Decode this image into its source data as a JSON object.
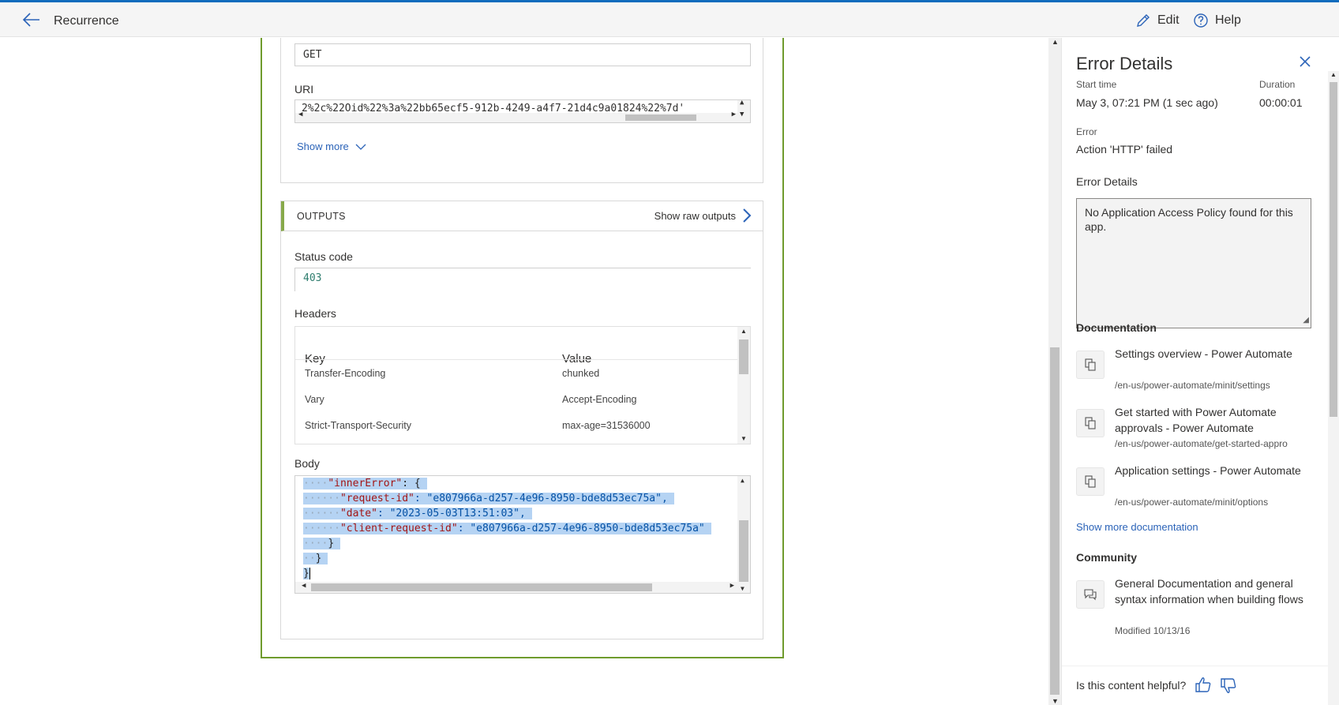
{
  "header": {
    "title": "Recurrence",
    "edit_label": "Edit",
    "help_label": "Help"
  },
  "inputs": {
    "method_value": "GET",
    "uri_label": "URI",
    "uri_value": "2%2c%22Oid%22%3a%22bb65ecf5-912b-4249-a4f7-21d4c9a01824%22%7d'",
    "show_more": "Show more"
  },
  "outputs": {
    "section_title": "OUTPUTS",
    "show_raw": "Show raw outputs",
    "status_label": "Status code",
    "status_value": "403",
    "headers_label": "Headers",
    "headers_columns": [
      "Key",
      "Value"
    ],
    "headers_rows": [
      {
        "key": "Transfer-Encoding",
        "value": "chunked"
      },
      {
        "key": "Vary",
        "value": "Accept-Encoding"
      },
      {
        "key": "Strict-Transport-Security",
        "value": "max-age=31536000"
      }
    ],
    "body_label": "Body",
    "body_lines": [
      {
        "indent": "····",
        "key": "\"innerError\"",
        "rest": ": {"
      },
      {
        "indent": "······",
        "key": "\"request-id\"",
        "rest": ": \"e807966a-d257-4e96-8950-bde8d53ec75a\","
      },
      {
        "indent": "······",
        "key": "\"date\"",
        "rest": ": \"2023-05-03T13:51:03\","
      },
      {
        "indent": "······",
        "key": "\"client-request-id\"",
        "rest": ": \"e807966a-d257-4e96-8950-bde8d53ec75a\""
      },
      {
        "indent": "····",
        "key": "",
        "rest": "}"
      },
      {
        "indent": "··",
        "key": "",
        "rest": "}"
      },
      {
        "indent": "",
        "key": "",
        "rest": "}"
      }
    ]
  },
  "panel": {
    "title": "Error Details",
    "start_time_label": "Start time",
    "start_time_value": "May 3, 07:21 PM (1 sec ago)",
    "duration_label": "Duration",
    "duration_value": "00:00:01",
    "error_label": "Error",
    "error_value": "Action 'HTTP' failed",
    "error_details_label": "Error Details",
    "error_details_text": "No Application Access Policy found for this app.",
    "documentation_label": "Documentation",
    "docs": [
      {
        "title": "Settings overview - Power Automate",
        "url": "/en-us/power-automate/minit/settings"
      },
      {
        "title": "Get started with Power Automate approvals - Power Automate",
        "url": "/en-us/power-automate/get-started-appro"
      },
      {
        "title": "Application settings - Power Automate",
        "url": "/en-us/power-automate/minit/options"
      }
    ],
    "show_more_docs": "Show more documentation",
    "community_label": "Community",
    "community": [
      {
        "title": "General Documentation and general syntax information when building flows",
        "meta": "Modified 10/13/16"
      }
    ],
    "helpful_label": "Is this content helpful?"
  },
  "colors": {
    "accent": "#2b63b8",
    "card_border": "#6f9b2d",
    "selection": "#b5d3f3",
    "json_key": "#a31515",
    "json_string": "#0451a5",
    "status_code": "#2e7d6e"
  }
}
